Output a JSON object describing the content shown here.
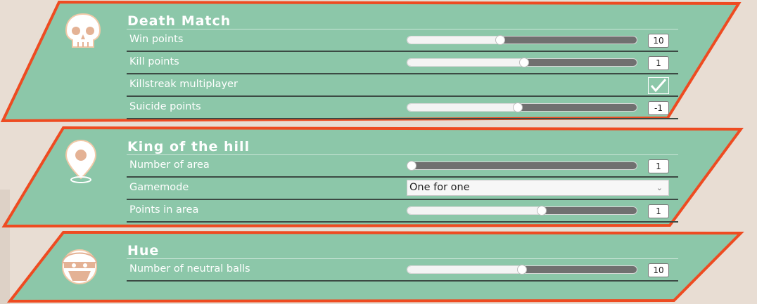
{
  "colors": {
    "panel_fill": "#8cc7a9",
    "panel_border": "#ee4b21",
    "background": "#e8ddd3"
  },
  "sections": [
    {
      "title": "Death Match",
      "icon": "skull-icon",
      "rows": [
        {
          "label": "Win points",
          "type": "slider",
          "level": 0.4,
          "value": "10"
        },
        {
          "label": "Kill points",
          "type": "slider",
          "level": 0.51,
          "value": "1"
        },
        {
          "label": "Killstreak multiplayer",
          "type": "checkbox",
          "checked": true
        },
        {
          "label": "Suicide points",
          "type": "slider",
          "level": 0.48,
          "value": "-1"
        }
      ]
    },
    {
      "title": "King of the hill",
      "icon": "location-pin-icon",
      "rows": [
        {
          "label": "Number of area",
          "type": "slider",
          "level": 0.0,
          "value": "1"
        },
        {
          "label": "Gamemode",
          "type": "select",
          "value": "One for one"
        },
        {
          "label": "Points in area",
          "type": "slider",
          "level": 0.59,
          "value": "1"
        }
      ]
    },
    {
      "title": "Hue",
      "icon": "masked-thief-icon",
      "rows": [
        {
          "label": "Number of neutral balls",
          "type": "slider",
          "level": 0.5,
          "value": "10"
        }
      ]
    }
  ]
}
